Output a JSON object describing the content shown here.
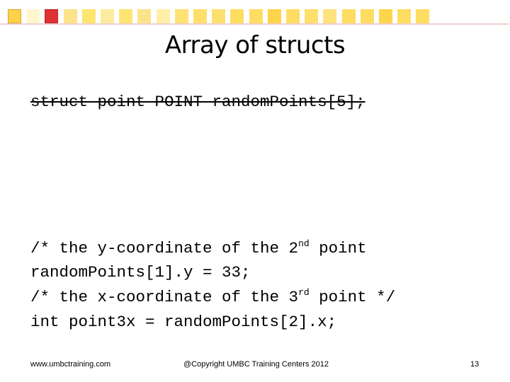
{
  "decoration": {
    "squares": [
      "#fdd248",
      "#fff6d0",
      "#e03232",
      "#fde28a",
      "#fee572",
      "#fdec9f",
      "#fee572",
      "#fbe38a",
      "#fff0a8",
      "#fee275",
      "#fedf6e",
      "#fee070",
      "#fedd62",
      "#fedd62",
      "#fed54a",
      "#fedd62",
      "#fedf6e",
      "#fee27c",
      "#fedd62",
      "#fedd62",
      "#fed54a",
      "#fedd62",
      "#fedd62"
    ],
    "line_color": "#ecd0cf"
  },
  "slide": {
    "title": "Array of structs",
    "code_lines": [
      {
        "text": "struct point POINT randomPoints[5];",
        "struck": true
      },
      {
        "pre": "/* the y-coordinate of the 2",
        "sup": "nd",
        "post": " point"
      },
      {
        "text": "randomPoints[1].y = 33;"
      },
      {
        "pre": "/* the x-coordinate of the 3",
        "sup": "rd",
        "post": " point */"
      },
      {
        "text": "int point3x = randomPoints[2].x;"
      }
    ]
  },
  "footer": {
    "website": "www.umbctraining.com",
    "copyright": "@Copyright UMBC Training Centers 2012",
    "page_number": "13"
  }
}
